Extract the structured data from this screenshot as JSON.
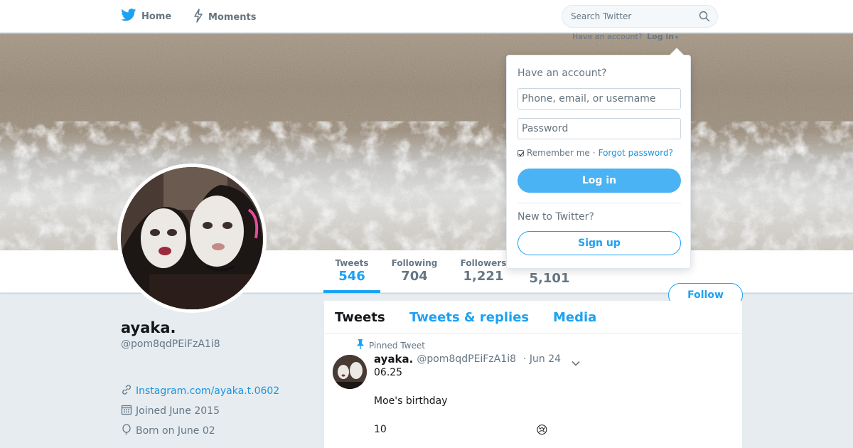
{
  "nav": {
    "home_label": "Home",
    "moments_label": "Moments",
    "search_placeholder": "Search Twitter",
    "account_prompt": "Have an account?",
    "login_label": "Log in",
    "brand_color": "#1da1f2"
  },
  "profile": {
    "name": "ayaka.",
    "handle": "@pom8qdPEiFzA1i8",
    "website": "Instagram.com/ayaka.t.0602",
    "joined": "Joined June 2015",
    "born": "Born on June 02",
    "follow_label": "Follow"
  },
  "stats": {
    "tweets_label": "Tweets",
    "tweets_value": "546",
    "following_label": "Following",
    "following_value": "704",
    "followers_label": "Followers",
    "followers_value": "1,221",
    "likes_value": "5,101"
  },
  "timeline": {
    "tabs": [
      "Tweets",
      "Tweets & replies",
      "Media"
    ],
    "pinned_label": "Pinned Tweet",
    "tweet": {
      "name": "ayaka.",
      "handle": "@pom8qdPEiFzA1i8",
      "date": "· Jun 24",
      "lines": [
        "06.25",
        "Moe's birthday",
        "10"
      ],
      "emoji": "😢"
    }
  },
  "login_dropdown": {
    "title": "Have an account?",
    "username_placeholder": "Phone, email, or username",
    "password_placeholder": "Password",
    "remember_label": "Remember me",
    "separator": "·",
    "forgot_label": "Forgot password?",
    "login_button": "Log in",
    "new_prompt": "New to Twitter?",
    "signup_button": "Sign up"
  }
}
